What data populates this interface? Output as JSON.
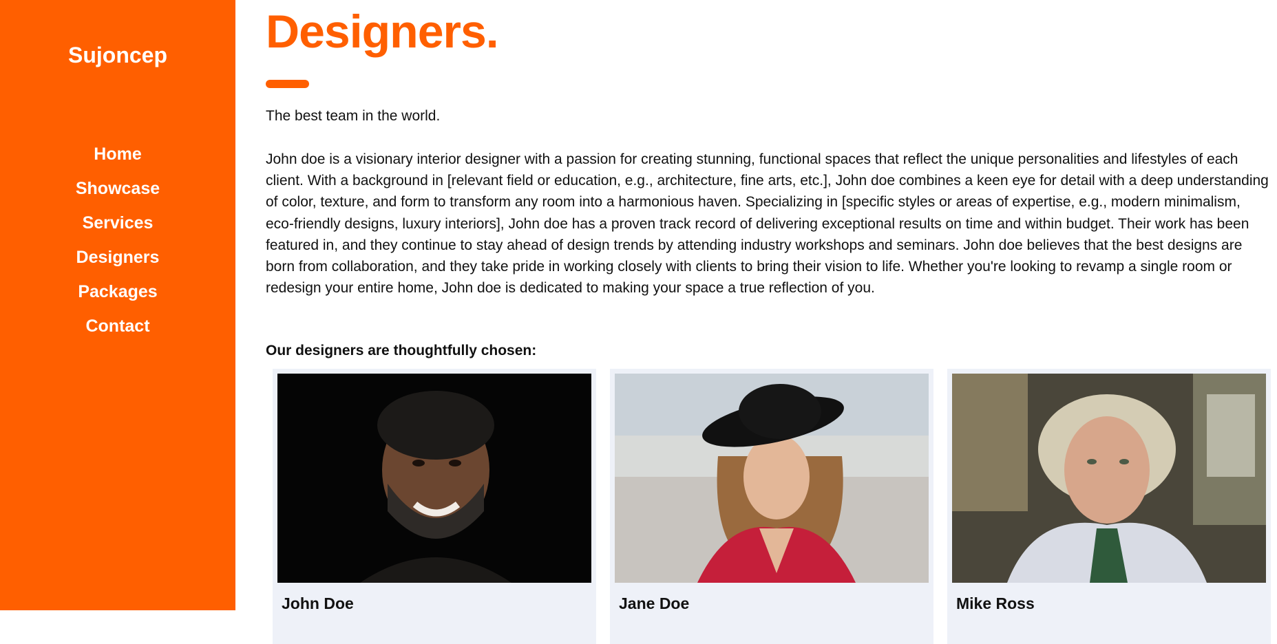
{
  "sidebar": {
    "brand": "Sujoncep",
    "nav": [
      {
        "label": "Home"
      },
      {
        "label": "Showcase"
      },
      {
        "label": "Services"
      },
      {
        "label": "Designers"
      },
      {
        "label": "Packages"
      },
      {
        "label": "Contact"
      }
    ]
  },
  "main": {
    "title": "Designers.",
    "tagline": "The best team in the world.",
    "bio": "John doe is a visionary interior designer with a passion for creating stunning, functional spaces that reflect the unique personalities and lifestyles of each client. With a background in [relevant field or education, e.g., architecture, fine arts, etc.], John doe combines a keen eye for detail with a deep understanding of color, texture, and form to transform any room into a harmonious haven. Specializing in [specific styles or areas of expertise, e.g., modern minimalism, eco-friendly designs, luxury interiors], John doe has a proven track record of delivering exceptional results on time and within budget. Their work has been featured in, and they continue to stay ahead of design trends by attending industry workshops and seminars. John doe believes that the best designs are born from collaboration, and they take pride in working closely with clients to bring their vision to life. Whether you're looking to revamp a single room or redesign your entire home, John doe is dedicated to making your space a true reflection of you.",
    "subheading": "Our designers are thoughtfully chosen:",
    "designers": [
      {
        "name": "John Doe"
      },
      {
        "name": "Jane Doe"
      },
      {
        "name": "Mike Ross"
      }
    ]
  },
  "colors": {
    "accent": "#ff5f00",
    "card_bg": "#eef1f8",
    "text": "#111111"
  }
}
